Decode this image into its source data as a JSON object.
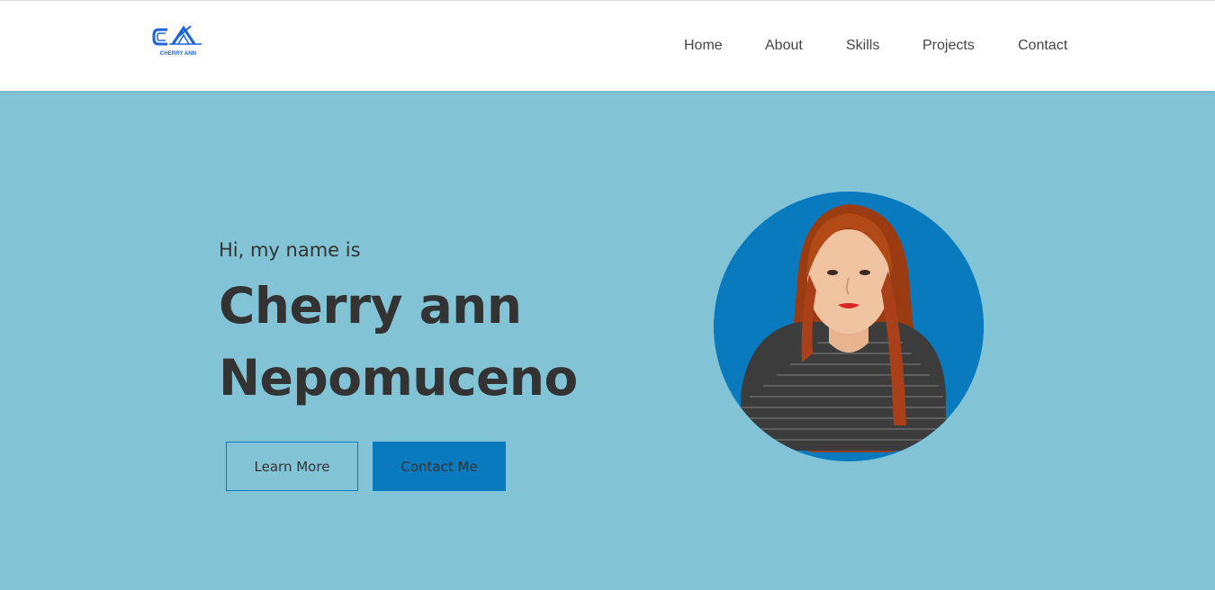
{
  "header": {
    "logo": {
      "mark": "CA",
      "text": "CHERRY ANN"
    },
    "nav": [
      {
        "label": "Home"
      },
      {
        "label": "About"
      },
      {
        "label": "Skills"
      },
      {
        "label": "Projects"
      },
      {
        "label": "Contact"
      }
    ]
  },
  "hero": {
    "greeting": "Hi, my name is",
    "name_line1": "Cherry ann",
    "name_line2": "Nepomuceno",
    "buttons": {
      "learn_more": "Learn More",
      "contact_me": "Contact Me"
    },
    "photo": {
      "icon": "profile-photo"
    }
  },
  "colors": {
    "page_background": "#82c3d5",
    "accent": "#0a7abf",
    "text": "#333333",
    "nav_text": "#444444",
    "logo": "#1b63d8"
  }
}
